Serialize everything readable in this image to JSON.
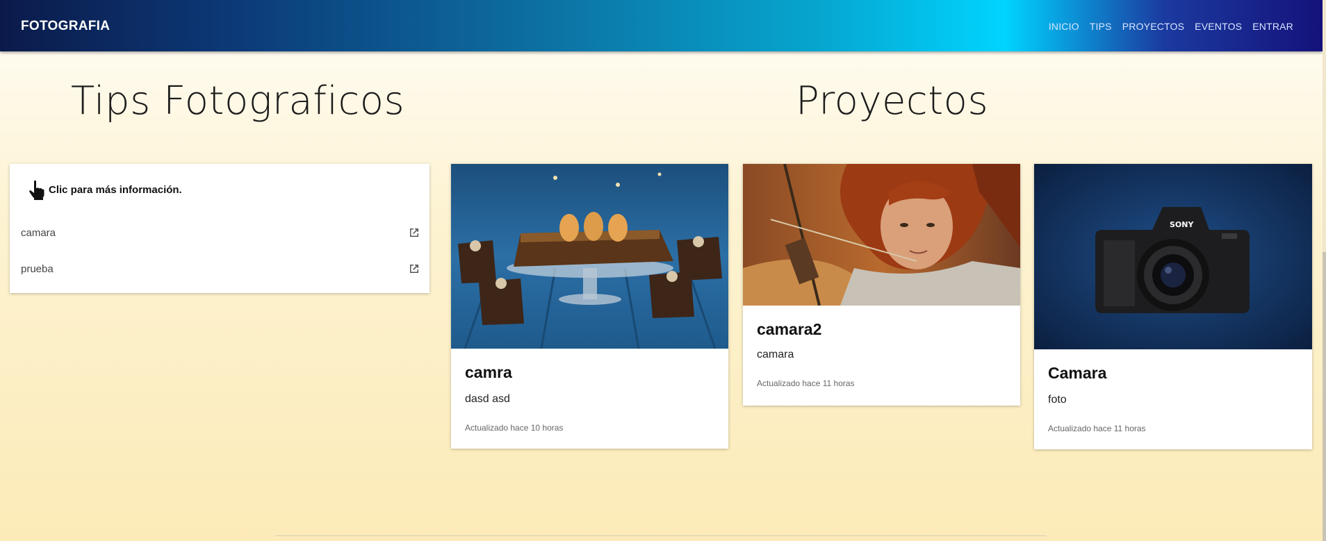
{
  "navbar": {
    "brand": "FOTOGRAFIA",
    "links": [
      "INICIO",
      "TIPS",
      "PROYECTOS",
      "EVENTOS",
      "ENTRAR"
    ],
    "gradient_colors": [
      "#0b1a4a",
      "#0d6ea0",
      "#00d4ff",
      "#14127a"
    ]
  },
  "tips": {
    "title": "Tips Fotograficos",
    "card_header": "Clic para más información.",
    "header_icon": "pointing-hand-icon",
    "items": [
      {
        "label": "camara",
        "icon": "open-in-new-icon"
      },
      {
        "label": "prueba",
        "icon": "open-in-new-icon"
      }
    ]
  },
  "projects": {
    "title": "Proyectos",
    "cards": [
      {
        "title": "camra",
        "description": "dasd asd",
        "updated": "Actualizado hace 10 horas",
        "image": "dessert-photo"
      },
      {
        "title": "camara2",
        "description": "camara",
        "updated": "Actualizado hace 11 horas",
        "image": "archer-portrait-photo"
      },
      {
        "title": "Camara",
        "description": "foto",
        "updated": "Actualizado hace 11 horas",
        "image": "sony-camera-photo"
      }
    ]
  }
}
